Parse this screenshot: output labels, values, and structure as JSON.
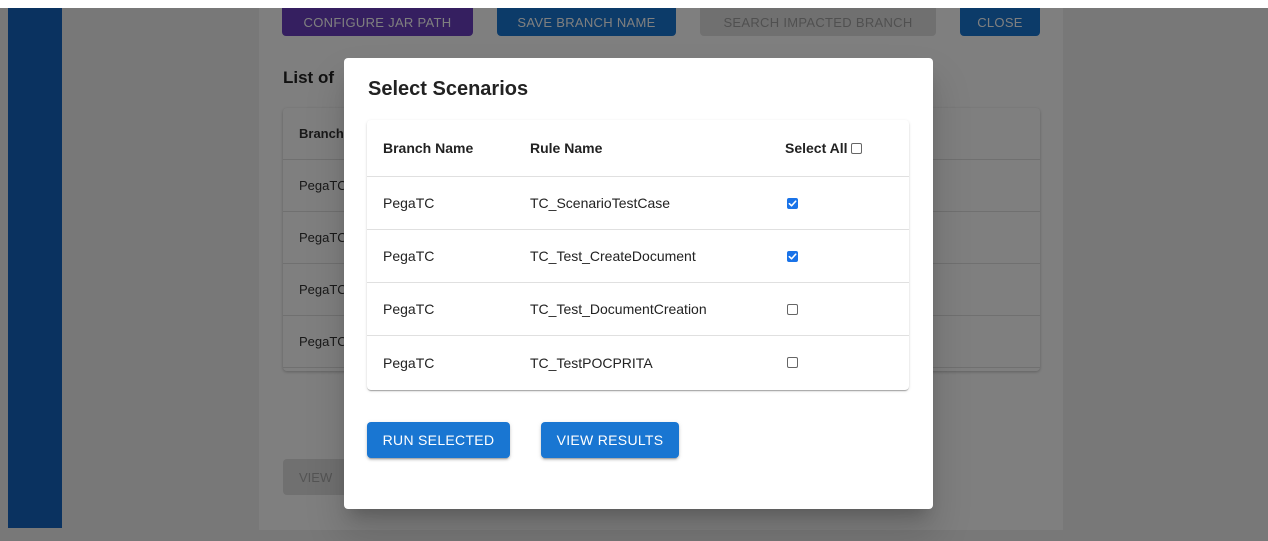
{
  "background": {
    "toolbar": {
      "configure_jar": "CONFIGURE JAR PATH",
      "save_branch": "SAVE BRANCH NAME",
      "search_impacted": "SEARCH IMPACTED BRANCH",
      "close": "CLOSE"
    },
    "list_title": "List of",
    "table": {
      "header": "Branch",
      "rows": [
        "PegaTC",
        "PegaTC",
        "PegaTC",
        "PegaTC"
      ]
    },
    "view_button": "VIEW"
  },
  "dialog": {
    "title": "Select Scenarios",
    "columns": {
      "branch": "Branch Name",
      "rule": "Rule Name",
      "select_all": "Select All"
    },
    "select_all_checked": false,
    "rows": [
      {
        "branch": "PegaTC",
        "rule": "TC_ScenarioTestCase",
        "checked": true
      },
      {
        "branch": "PegaTC",
        "rule": "TC_Test_CreateDocument",
        "checked": true
      },
      {
        "branch": "PegaTC",
        "rule": "TC_Test_DocumentCreation",
        "checked": false
      },
      {
        "branch": "PegaTC",
        "rule": "TC_TestPOCPRITA",
        "checked": false
      }
    ],
    "actions": {
      "run_selected": "RUN SELECTED",
      "view_results": "VIEW RESULTS"
    }
  },
  "colors": {
    "primary": "#1976d2",
    "secondary": "#6a3fc0",
    "rail": "#1565c0",
    "checkbox_checked": "#1a73e8"
  }
}
